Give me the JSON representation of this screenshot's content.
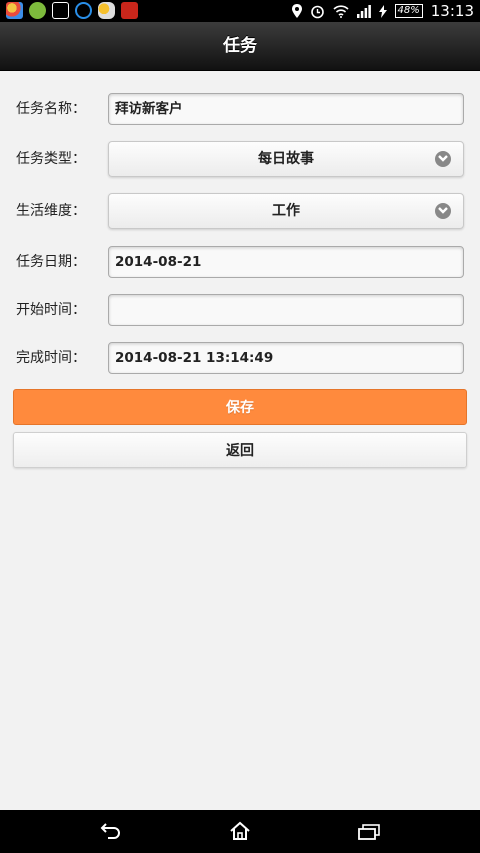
{
  "status_bar": {
    "time": "13:13",
    "battery": "48%",
    "left_icons": [
      "app-icon-1",
      "chat-icon",
      "gallery-icon",
      "download-icon",
      "weather-icon",
      "game-icon"
    ],
    "right_icons": [
      "location-icon",
      "alarm-icon",
      "wifi-icon",
      "signal-icon",
      "charging-icon"
    ]
  },
  "header": {
    "title": "任务"
  },
  "form": {
    "task_name": {
      "label": "任务名称：",
      "value": "拜访新客户"
    },
    "task_type": {
      "label": "任务类型：",
      "value": "每日故事"
    },
    "life_dimension": {
      "label": "生活维度：",
      "value": "工作"
    },
    "task_date": {
      "label": "任务日期：",
      "value": "2014-08-21"
    },
    "start_time": {
      "label": "开始时间：",
      "value": ""
    },
    "finish_time": {
      "label": "完成时间：",
      "value": "2014-08-21 13:14:49"
    }
  },
  "actions": {
    "save": "保存",
    "back": "返回"
  },
  "nav_bar": {
    "icons": [
      "back-icon",
      "home-icon",
      "recent-apps-icon"
    ]
  },
  "colors": {
    "accent": "#ff8a3d",
    "header_bg": "#1a1a1a",
    "page_bg": "#f2f2f2"
  }
}
